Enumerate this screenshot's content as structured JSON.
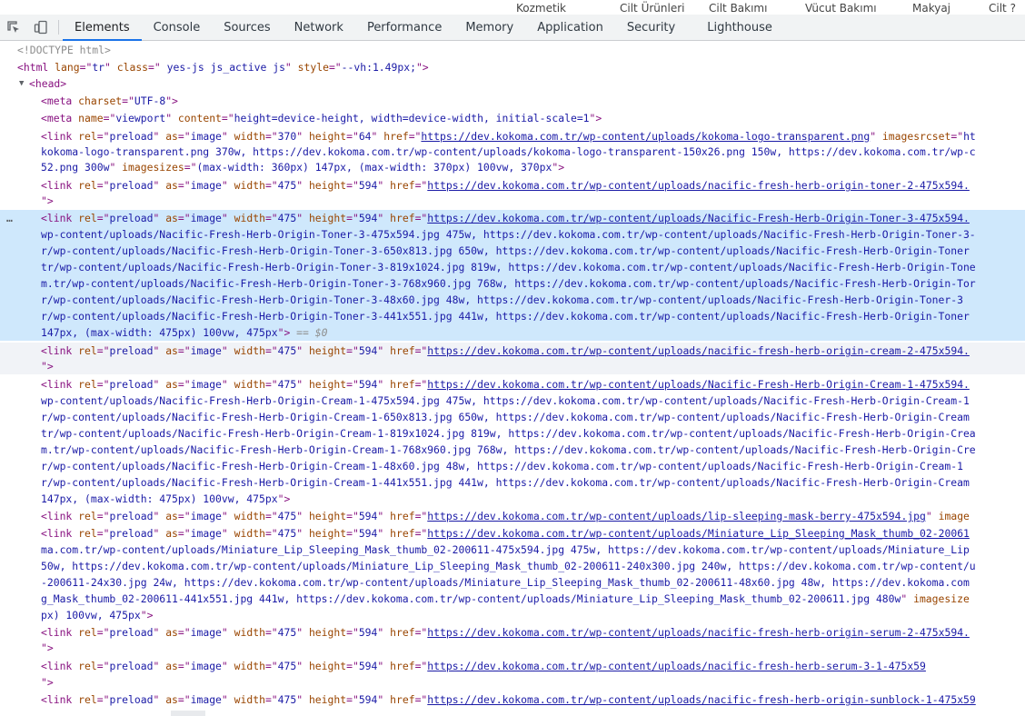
{
  "top_strip": [
    "Kozmetik",
    "Cilt Ürünleri",
    "Cilt Bakımı",
    "Vücut Bakımı",
    "Makyaj",
    "Cilt ?"
  ],
  "tabs": [
    "Elements",
    "Console",
    "Sources",
    "Network",
    "Performance",
    "Memory",
    "Application",
    "Security",
    "Lighthouse"
  ],
  "active_tab": "Elements",
  "icons": {
    "inspect": "inspect-element-icon",
    "device": "device-toolbar-icon"
  },
  "selected_suffix": "== $0",
  "lines": [
    [
      [
        "cm",
        "<!DOCTYPE html>"
      ]
    ],
    [
      [
        "tag",
        "<html "
      ],
      [
        "an",
        "lang"
      ],
      [
        "tag",
        "=\""
      ],
      [
        "av",
        "tr"
      ],
      [
        "tag",
        "\" "
      ],
      [
        "an",
        "class"
      ],
      [
        "tag",
        "=\""
      ],
      [
        "av",
        " yes-js js_active js"
      ],
      [
        "tag",
        "\" "
      ],
      [
        "an",
        "style"
      ],
      [
        "tag",
        "=\""
      ],
      [
        "av",
        "--vh:1.49px;"
      ],
      [
        "tag",
        "\">"
      ]
    ],
    [
      [
        "tag",
        "<head>"
      ]
    ],
    [
      [
        "tag",
        "<meta "
      ],
      [
        "an",
        "charset"
      ],
      [
        "tag",
        "=\""
      ],
      [
        "av",
        "UTF-8"
      ],
      [
        "tag",
        "\">"
      ]
    ],
    [
      [
        "tag",
        "<meta "
      ],
      [
        "an",
        "name"
      ],
      [
        "tag",
        "=\""
      ],
      [
        "av",
        "viewport"
      ],
      [
        "tag",
        "\" "
      ],
      [
        "an",
        "content"
      ],
      [
        "tag",
        "=\""
      ],
      [
        "av",
        "height=device-height, width=device-width, initial-scale=1"
      ],
      [
        "tag",
        "\">"
      ]
    ],
    [
      [
        "tag",
        "<link "
      ],
      [
        "an",
        "rel"
      ],
      [
        "tag",
        "=\""
      ],
      [
        "av",
        "preload"
      ],
      [
        "tag",
        "\" "
      ],
      [
        "an",
        "as"
      ],
      [
        "tag",
        "=\""
      ],
      [
        "av",
        "image"
      ],
      [
        "tag",
        "\" "
      ],
      [
        "an",
        "width"
      ],
      [
        "tag",
        "=\""
      ],
      [
        "av",
        "370"
      ],
      [
        "tag",
        "\" "
      ],
      [
        "an",
        "height"
      ],
      [
        "tag",
        "=\""
      ],
      [
        "av",
        "64"
      ],
      [
        "tag",
        "\" "
      ],
      [
        "an",
        "href"
      ],
      [
        "tag",
        "=\""
      ],
      [
        "url",
        "https://dev.kokoma.com.tr/wp-content/uploads/kokoma-logo-transparent.png"
      ],
      [
        "tag",
        "\" "
      ],
      [
        "an",
        "imagesrcset"
      ],
      [
        "tag",
        "=\""
      ],
      [
        "av",
        "ht"
      ]
    ],
    [
      [
        "av",
        "kokoma-logo-transparent.png 370w, https://dev.kokoma.com.tr/wp-content/uploads/kokoma-logo-transparent-150x26.png 150w, https://dev.kokoma.com.tr/wp-c"
      ]
    ],
    [
      [
        "av",
        "52.png 300w"
      ],
      [
        "tag",
        "\" "
      ],
      [
        "an",
        "imagesizes"
      ],
      [
        "tag",
        "=\""
      ],
      [
        "av",
        "(max-width: 360px) 147px, (max-width: 370px) 100vw, 370px"
      ],
      [
        "tag",
        "\">"
      ]
    ],
    [
      [
        "tag",
        "<link "
      ],
      [
        "an",
        "rel"
      ],
      [
        "tag",
        "=\""
      ],
      [
        "av",
        "preload"
      ],
      [
        "tag",
        "\" "
      ],
      [
        "an",
        "as"
      ],
      [
        "tag",
        "=\""
      ],
      [
        "av",
        "image"
      ],
      [
        "tag",
        "\" "
      ],
      [
        "an",
        "width"
      ],
      [
        "tag",
        "=\""
      ],
      [
        "av",
        "475"
      ],
      [
        "tag",
        "\" "
      ],
      [
        "an",
        "height"
      ],
      [
        "tag",
        "=\""
      ],
      [
        "av",
        "594"
      ],
      [
        "tag",
        "\" "
      ],
      [
        "an",
        "href"
      ],
      [
        "tag",
        "=\""
      ],
      [
        "url",
        "https://dev.kokoma.com.tr/wp-content/uploads/nacific-fresh-herb-origin-toner-2-475x594."
      ]
    ],
    [
      [
        "tag",
        "\">"
      ]
    ],
    [
      [
        "tag",
        "<link "
      ],
      [
        "an",
        "rel"
      ],
      [
        "tag",
        "=\""
      ],
      [
        "av",
        "preload"
      ],
      [
        "tag",
        "\" "
      ],
      [
        "an",
        "as"
      ],
      [
        "tag",
        "=\""
      ],
      [
        "av",
        "image"
      ],
      [
        "tag",
        "\" "
      ],
      [
        "an",
        "width"
      ],
      [
        "tag",
        "=\""
      ],
      [
        "av",
        "475"
      ],
      [
        "tag",
        "\" "
      ],
      [
        "an",
        "height"
      ],
      [
        "tag",
        "=\""
      ],
      [
        "av",
        "594"
      ],
      [
        "tag",
        "\" "
      ],
      [
        "an",
        "href"
      ],
      [
        "tag",
        "=\""
      ],
      [
        "url",
        "https://dev.kokoma.com.tr/wp-content/uploads/Nacific-Fresh-Herb-Origin-Toner-3-475x594."
      ]
    ],
    [
      [
        "av",
        "wp-content/uploads/Nacific-Fresh-Herb-Origin-Toner-3-475x594.jpg 475w, https://dev.kokoma.com.tr/wp-content/uploads/Nacific-Fresh-Herb-Origin-Toner-3-"
      ]
    ],
    [
      [
        "av",
        "r/wp-content/uploads/Nacific-Fresh-Herb-Origin-Toner-3-650x813.jpg 650w, https://dev.kokoma.com.tr/wp-content/uploads/Nacific-Fresh-Herb-Origin-Toner"
      ]
    ],
    [
      [
        "av",
        "tr/wp-content/uploads/Nacific-Fresh-Herb-Origin-Toner-3-819x1024.jpg 819w, https://dev.kokoma.com.tr/wp-content/uploads/Nacific-Fresh-Herb-Origin-Tone"
      ]
    ],
    [
      [
        "av",
        "m.tr/wp-content/uploads/Nacific-Fresh-Herb-Origin-Toner-3-768x960.jpg 768w, https://dev.kokoma.com.tr/wp-content/uploads/Nacific-Fresh-Herb-Origin-Tor"
      ]
    ],
    [
      [
        "av",
        "r/wp-content/uploads/Nacific-Fresh-Herb-Origin-Toner-3-48x60.jpg 48w, https://dev.kokoma.com.tr/wp-content/uploads/Nacific-Fresh-Herb-Origin-Toner-3"
      ]
    ],
    [
      [
        "av",
        "r/wp-content/uploads/Nacific-Fresh-Herb-Origin-Toner-3-441x551.jpg 441w, https://dev.kokoma.com.tr/wp-content/uploads/Nacific-Fresh-Herb-Origin-Toner"
      ]
    ],
    [
      [
        "av",
        "147px, (max-width: 475px) 100vw, 475px"
      ],
      [
        "tag",
        "\">"
      ]
    ],
    [
      [
        "tag",
        "<link "
      ],
      [
        "an",
        "rel"
      ],
      [
        "tag",
        "=\""
      ],
      [
        "av",
        "preload"
      ],
      [
        "tag",
        "\" "
      ],
      [
        "an",
        "as"
      ],
      [
        "tag",
        "=\""
      ],
      [
        "av",
        "image"
      ],
      [
        "tag",
        "\" "
      ],
      [
        "an",
        "width"
      ],
      [
        "tag",
        "=\""
      ],
      [
        "av",
        "475"
      ],
      [
        "tag",
        "\" "
      ],
      [
        "an",
        "height"
      ],
      [
        "tag",
        "=\""
      ],
      [
        "av",
        "594"
      ],
      [
        "tag",
        "\" "
      ],
      [
        "an",
        "href"
      ],
      [
        "tag",
        "=\""
      ],
      [
        "url",
        "https://dev.kokoma.com.tr/wp-content/uploads/nacific-fresh-herb-origin-cream-2-475x594."
      ]
    ],
    [
      [
        "tag",
        "\">"
      ]
    ],
    [
      [
        "tag",
        "<link "
      ],
      [
        "an",
        "rel"
      ],
      [
        "tag",
        "=\""
      ],
      [
        "av",
        "preload"
      ],
      [
        "tag",
        "\" "
      ],
      [
        "an",
        "as"
      ],
      [
        "tag",
        "=\""
      ],
      [
        "av",
        "image"
      ],
      [
        "tag",
        "\" "
      ],
      [
        "an",
        "width"
      ],
      [
        "tag",
        "=\""
      ],
      [
        "av",
        "475"
      ],
      [
        "tag",
        "\" "
      ],
      [
        "an",
        "height"
      ],
      [
        "tag",
        "=\""
      ],
      [
        "av",
        "594"
      ],
      [
        "tag",
        "\" "
      ],
      [
        "an",
        "href"
      ],
      [
        "tag",
        "=\""
      ],
      [
        "url",
        "https://dev.kokoma.com.tr/wp-content/uploads/Nacific-Fresh-Herb-Origin-Cream-1-475x594."
      ]
    ],
    [
      [
        "av",
        "wp-content/uploads/Nacific-Fresh-Herb-Origin-Cream-1-475x594.jpg 475w, https://dev.kokoma.com.tr/wp-content/uploads/Nacific-Fresh-Herb-Origin-Cream-1"
      ]
    ],
    [
      [
        "av",
        "r/wp-content/uploads/Nacific-Fresh-Herb-Origin-Cream-1-650x813.jpg 650w, https://dev.kokoma.com.tr/wp-content/uploads/Nacific-Fresh-Herb-Origin-Cream"
      ]
    ],
    [
      [
        "av",
        "tr/wp-content/uploads/Nacific-Fresh-Herb-Origin-Cream-1-819x1024.jpg 819w, https://dev.kokoma.com.tr/wp-content/uploads/Nacific-Fresh-Herb-Origin-Crea"
      ]
    ],
    [
      [
        "av",
        "m.tr/wp-content/uploads/Nacific-Fresh-Herb-Origin-Cream-1-768x960.jpg 768w, https://dev.kokoma.com.tr/wp-content/uploads/Nacific-Fresh-Herb-Origin-Cre"
      ]
    ],
    [
      [
        "av",
        "r/wp-content/uploads/Nacific-Fresh-Herb-Origin-Cream-1-48x60.jpg 48w, https://dev.kokoma.com.tr/wp-content/uploads/Nacific-Fresh-Herb-Origin-Cream-1"
      ]
    ],
    [
      [
        "av",
        "r/wp-content/uploads/Nacific-Fresh-Herb-Origin-Cream-1-441x551.jpg 441w, https://dev.kokoma.com.tr/wp-content/uploads/Nacific-Fresh-Herb-Origin-Cream"
      ]
    ],
    [
      [
        "av",
        "147px, (max-width: 475px) 100vw, 475px"
      ],
      [
        "tag",
        "\">"
      ]
    ],
    [
      [
        "tag",
        "<link "
      ],
      [
        "an",
        "rel"
      ],
      [
        "tag",
        "=\""
      ],
      [
        "av",
        "preload"
      ],
      [
        "tag",
        "\" "
      ],
      [
        "an",
        "as"
      ],
      [
        "tag",
        "=\""
      ],
      [
        "av",
        "image"
      ],
      [
        "tag",
        "\" "
      ],
      [
        "an",
        "width"
      ],
      [
        "tag",
        "=\""
      ],
      [
        "av",
        "475"
      ],
      [
        "tag",
        "\" "
      ],
      [
        "an",
        "height"
      ],
      [
        "tag",
        "=\""
      ],
      [
        "av",
        "594"
      ],
      [
        "tag",
        "\" "
      ],
      [
        "an",
        "href"
      ],
      [
        "tag",
        "=\""
      ],
      [
        "url",
        "https://dev.kokoma.com.tr/wp-content/uploads/lip-sleeping-mask-berry-475x594.jpg"
      ],
      [
        "tag",
        "\" "
      ],
      [
        "an",
        "image"
      ]
    ],
    [
      [
        "tag",
        "<link "
      ],
      [
        "an",
        "rel"
      ],
      [
        "tag",
        "=\""
      ],
      [
        "av",
        "preload"
      ],
      [
        "tag",
        "\" "
      ],
      [
        "an",
        "as"
      ],
      [
        "tag",
        "=\""
      ],
      [
        "av",
        "image"
      ],
      [
        "tag",
        "\" "
      ],
      [
        "an",
        "width"
      ],
      [
        "tag",
        "=\""
      ],
      [
        "av",
        "475"
      ],
      [
        "tag",
        "\" "
      ],
      [
        "an",
        "height"
      ],
      [
        "tag",
        "=\""
      ],
      [
        "av",
        "594"
      ],
      [
        "tag",
        "\" "
      ],
      [
        "an",
        "href"
      ],
      [
        "tag",
        "=\""
      ],
      [
        "url",
        "https://dev.kokoma.com.tr/wp-content/uploads/Miniature_Lip_Sleeping_Mask_thumb_02-20061"
      ]
    ],
    [
      [
        "av",
        "ma.com.tr/wp-content/uploads/Miniature_Lip_Sleeping_Mask_thumb_02-200611-475x594.jpg 475w, https://dev.kokoma.com.tr/wp-content/uploads/Miniature_Lip"
      ]
    ],
    [
      [
        "av",
        "50w, https://dev.kokoma.com.tr/wp-content/uploads/Miniature_Lip_Sleeping_Mask_thumb_02-200611-240x300.jpg 240w, https://dev.kokoma.com.tr/wp-content/u"
      ]
    ],
    [
      [
        "av",
        "-200611-24x30.jpg 24w, https://dev.kokoma.com.tr/wp-content/uploads/Miniature_Lip_Sleeping_Mask_thumb_02-200611-48x60.jpg 48w, https://dev.kokoma.com"
      ]
    ],
    [
      [
        "av",
        "g_Mask_thumb_02-200611-441x551.jpg 441w, https://dev.kokoma.com.tr/wp-content/uploads/Miniature_Lip_Sleeping_Mask_thumb_02-200611.jpg 480w"
      ],
      [
        "tag",
        "\" "
      ],
      [
        "an",
        "imagesize"
      ]
    ],
    [
      [
        "av",
        "px) 100vw, 475px"
      ],
      [
        "tag",
        "\">"
      ]
    ],
    [
      [
        "tag",
        "<link "
      ],
      [
        "an",
        "rel"
      ],
      [
        "tag",
        "=\""
      ],
      [
        "av",
        "preload"
      ],
      [
        "tag",
        "\" "
      ],
      [
        "an",
        "as"
      ],
      [
        "tag",
        "=\""
      ],
      [
        "av",
        "image"
      ],
      [
        "tag",
        "\" "
      ],
      [
        "an",
        "width"
      ],
      [
        "tag",
        "=\""
      ],
      [
        "av",
        "475"
      ],
      [
        "tag",
        "\" "
      ],
      [
        "an",
        "height"
      ],
      [
        "tag",
        "=\""
      ],
      [
        "av",
        "594"
      ],
      [
        "tag",
        "\" "
      ],
      [
        "an",
        "href"
      ],
      [
        "tag",
        "=\""
      ],
      [
        "url",
        "https://dev.kokoma.com.tr/wp-content/uploads/nacific-fresh-herb-origin-serum-2-475x594."
      ]
    ],
    [
      [
        "tag",
        "\">"
      ]
    ],
    [
      [
        "tag",
        "<link "
      ],
      [
        "an",
        "rel"
      ],
      [
        "tag",
        "=\""
      ],
      [
        "av",
        "preload"
      ],
      [
        "tag",
        "\" "
      ],
      [
        "an",
        "as"
      ],
      [
        "tag",
        "=\""
      ],
      [
        "av",
        "image"
      ],
      [
        "tag",
        "\" "
      ],
      [
        "an",
        "width"
      ],
      [
        "tag",
        "=\""
      ],
      [
        "av",
        "475"
      ],
      [
        "tag",
        "\" "
      ],
      [
        "an",
        "height"
      ],
      [
        "tag",
        "=\""
      ],
      [
        "av",
        "594"
      ],
      [
        "tag",
        "\" "
      ],
      [
        "an",
        "href"
      ],
      [
        "tag",
        "=\""
      ],
      [
        "url",
        "https://dev.kokoma.com.tr/wp-content/uploads/nacific-fresh-herb-serum-3-1-475x59"
      ]
    ],
    [
      [
        "tag",
        "\">"
      ]
    ],
    [
      [
        "tag",
        "<link "
      ],
      [
        "an",
        "rel"
      ],
      [
        "tag",
        "=\""
      ],
      [
        "av",
        "preload"
      ],
      [
        "tag",
        "\" "
      ],
      [
        "an",
        "as"
      ],
      [
        "tag",
        "=\""
      ],
      [
        "av",
        "image"
      ],
      [
        "tag",
        "\" "
      ],
      [
        "an",
        "width"
      ],
      [
        "tag",
        "=\""
      ],
      [
        "av",
        "475"
      ],
      [
        "tag",
        "\" "
      ],
      [
        "an",
        "height"
      ],
      [
        "tag",
        "=\""
      ],
      [
        "av",
        "594"
      ],
      [
        "tag",
        "\" "
      ],
      [
        "an",
        "href"
      ],
      [
        "tag",
        "=\""
      ],
      [
        "url",
        "https://dev.kokoma.com.tr/wp-content/uploads/nacific-fresh-herb-origin-sunblock-1-475x59"
      ]
    ]
  ]
}
